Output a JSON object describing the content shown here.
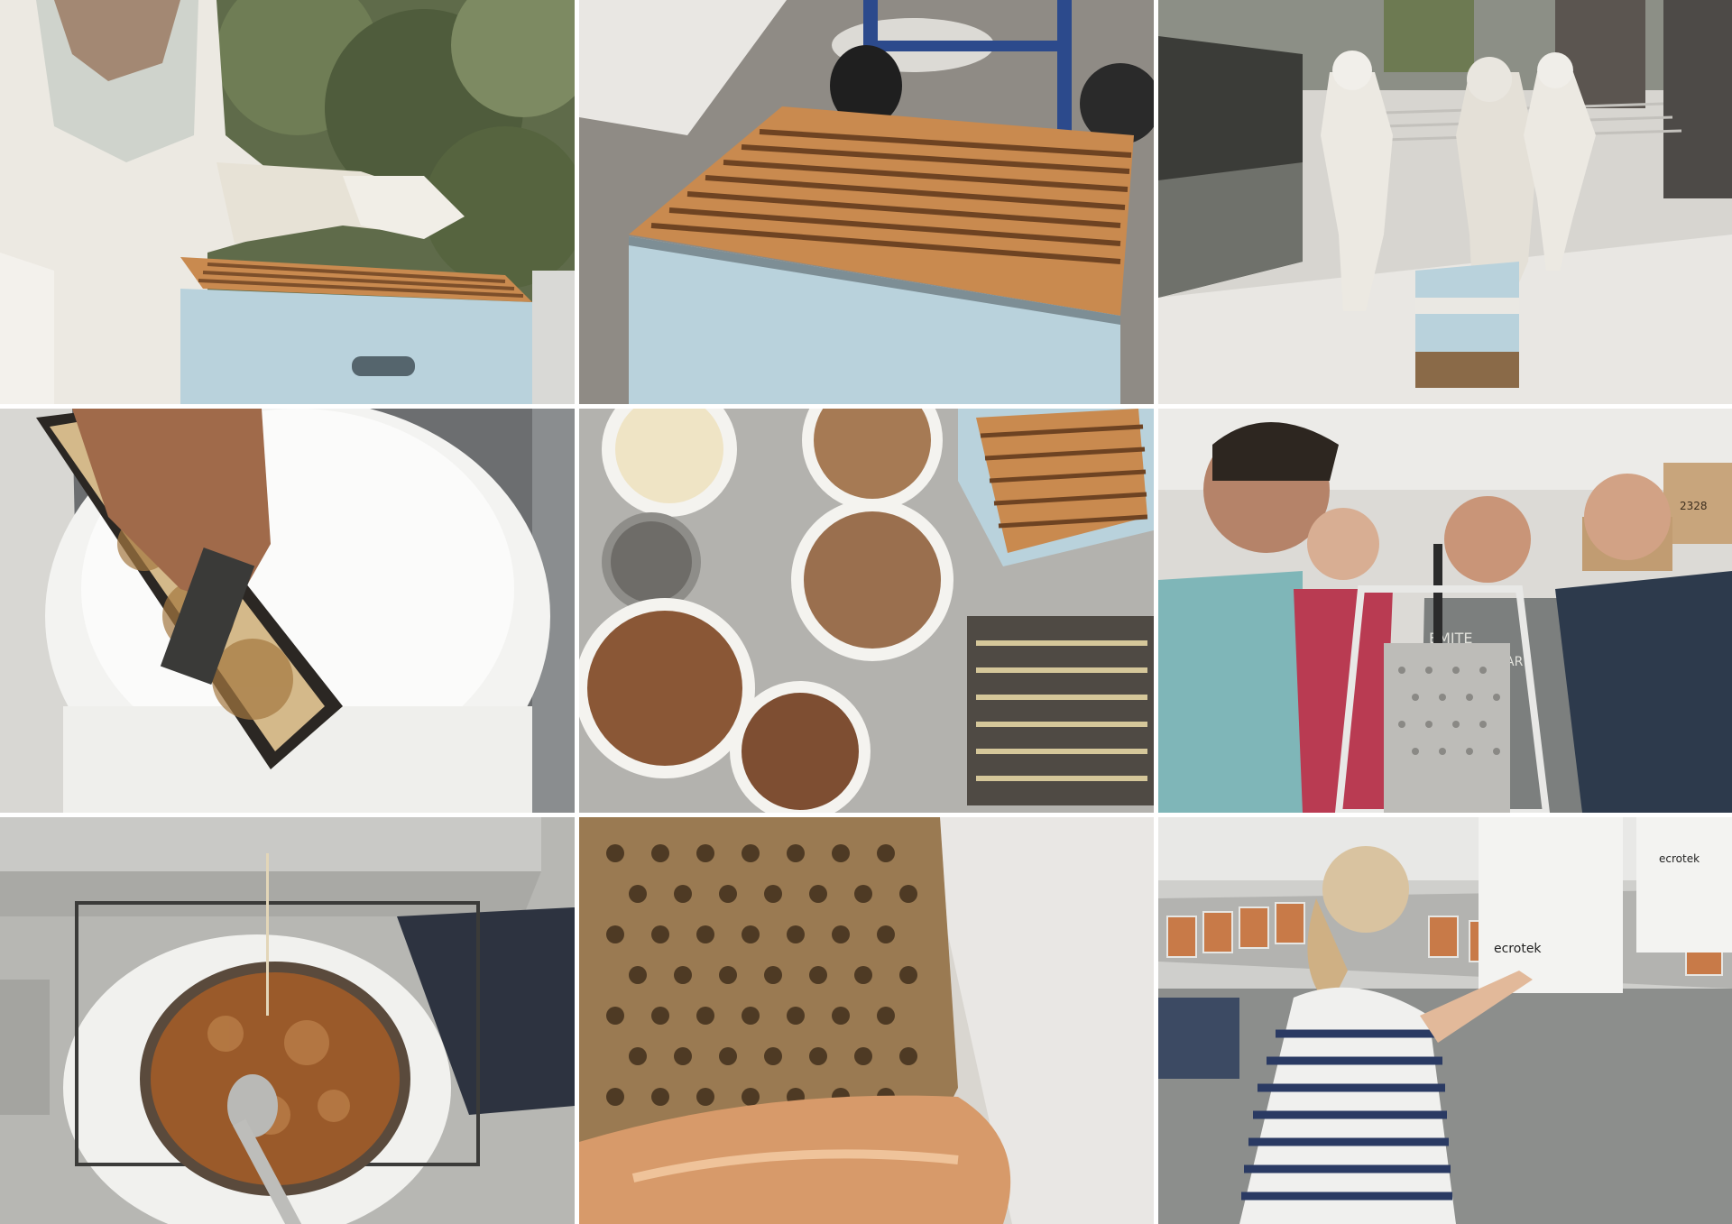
{
  "gallery": {
    "layout": "3x3 photo grid",
    "photos": [
      {
        "subject": "beekeeper-inspecting-hive"
      },
      {
        "subject": "open-hive-box-on-trolley"
      },
      {
        "subject": "beekeepers-wheeling-hive"
      },
      {
        "subject": "uncapping-honeycomb-frame"
      },
      {
        "subject": "buckets-of-honeycomb-from-above"
      },
      {
        "subject": "group-pressing-honeycomb"
      },
      {
        "subject": "honey-draining-into-bucket"
      },
      {
        "subject": "honey-strainer-closeup"
      },
      {
        "subject": "woman-filling-honey-jars"
      }
    ]
  },
  "printed_text": {
    "bucket_brand": "ecrotek",
    "shelf_box_number": "2328",
    "shirt_text": "YOSEMITE NATIONAL PARK",
    "shirt_text_partial_1": "EMITE",
    "shirt_text_partial_2": "IONAL PAR"
  },
  "colors": {
    "hive_blue": "#b9d2dc",
    "honey_amber": "#9a5a2a",
    "wood_orange": "#c98a4f",
    "steel_grey": "#c9c9c6",
    "suit_white": "#ece9e2"
  }
}
